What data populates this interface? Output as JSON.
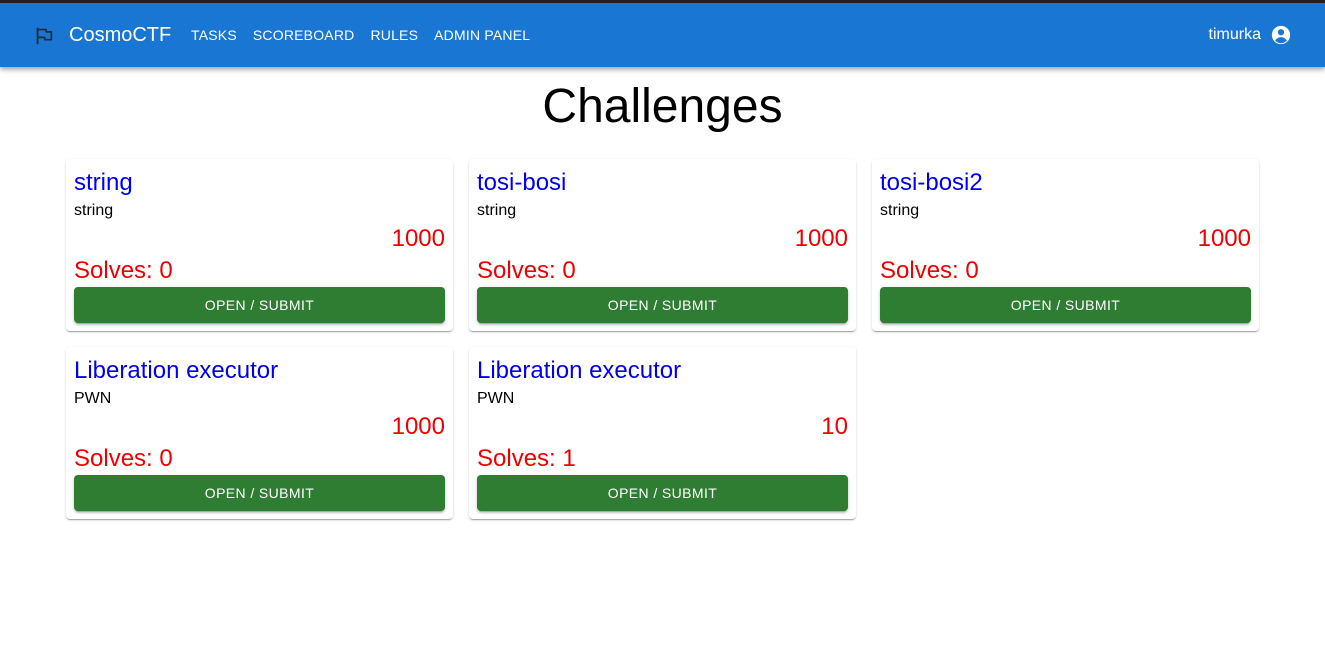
{
  "header": {
    "logo_icon": "flag-icon",
    "brand": "CosmoCTF",
    "nav": [
      {
        "label": "TASKS"
      },
      {
        "label": "SCOREBOARD"
      },
      {
        "label": "RULES"
      },
      {
        "label": "ADMIN PANEL"
      }
    ],
    "username": "timurka",
    "account_icon": "account-circle-icon",
    "colors": {
      "appbar": "#1976d2",
      "text": "#ffffff"
    }
  },
  "page": {
    "title": "Challenges"
  },
  "challenges": [
    {
      "title": "string",
      "category": "string",
      "points": "1000",
      "solves": "Solves: 0",
      "button": "OPEN / SUBMIT"
    },
    {
      "title": "tosi-bosi",
      "category": "string",
      "points": "1000",
      "solves": "Solves: 0",
      "button": "OPEN / SUBMIT"
    },
    {
      "title": "tosi-bosi2",
      "category": "string",
      "points": "1000",
      "solves": "Solves: 0",
      "button": "OPEN / SUBMIT"
    },
    {
      "title": "Liberation executor",
      "category": "PWN",
      "points": "1000",
      "solves": "Solves: 0",
      "button": "OPEN / SUBMIT"
    },
    {
      "title": "Liberation executor",
      "category": "PWN",
      "points": "10",
      "solves": "Solves: 1",
      "button": "OPEN / SUBMIT"
    }
  ],
  "colors": {
    "title_link": "#0000ee",
    "points": "#ee0000",
    "button": "#2e7d32"
  }
}
